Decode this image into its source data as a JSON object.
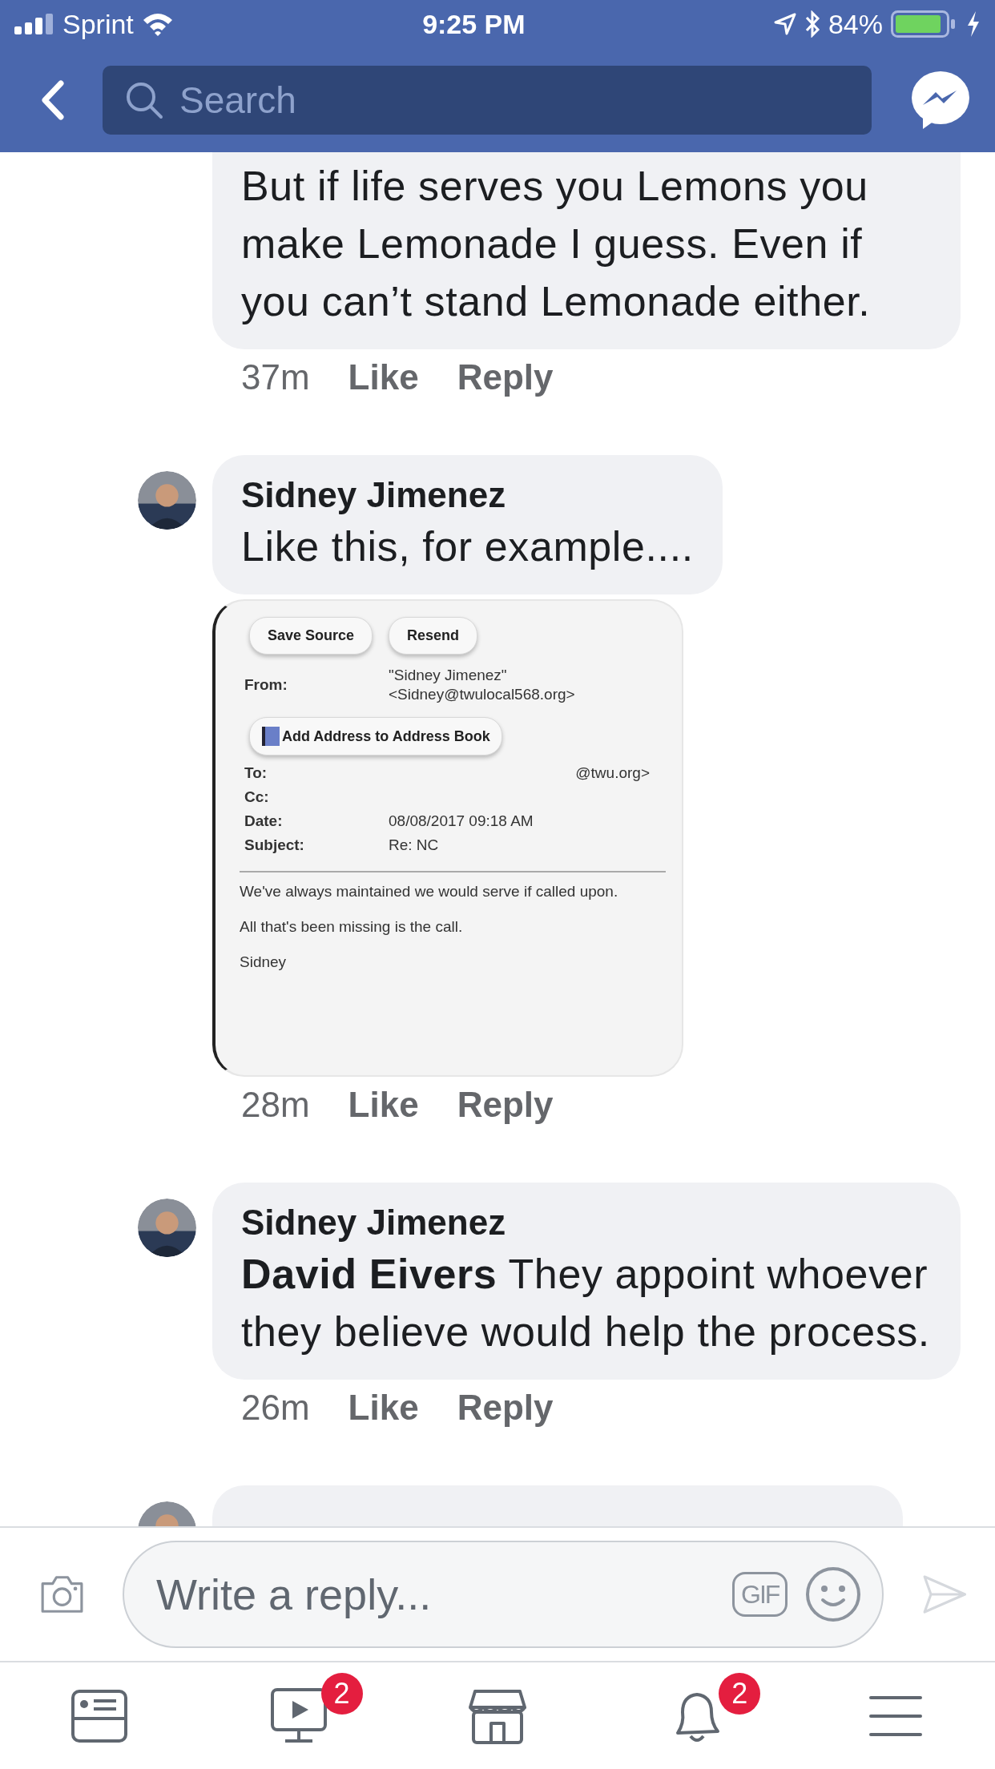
{
  "status_bar": {
    "carrier": "Sprint",
    "time": "9:25 PM",
    "battery": "84%"
  },
  "header": {
    "search": {
      "placeholder": "Search"
    }
  },
  "comments": [
    {
      "kind": "cut",
      "text": "But if life serves you Lemons you make Lemonade I guess. Even if you can’t stand Lemonade either.",
      "time": "37m",
      "like": "Like",
      "reply": "Reply"
    },
    {
      "kind": "full",
      "author": "Sidney Jimenez",
      "text": "Like this, for example....",
      "time": "28m",
      "like": "Like",
      "reply": "Reply",
      "attachment": {
        "buttons": [
          "Save Source",
          "Resend"
        ],
        "from_label": "From:",
        "from_value": [
          "\"Sidney Jimenez\"",
          "<Sidney@twulocal568.org>"
        ],
        "address_button": "Add Address to Address Book",
        "fields": [
          {
            "label": "To:",
            "value": "@twu.org>"
          },
          {
            "label": "Cc:"
          },
          {
            "label": "Date:",
            "value": "08/08/2017 09:18 AM"
          },
          {
            "label": "Subject:",
            "value": "Re: NC"
          }
        ],
        "body": [
          "We've always maintained we would serve if called upon.",
          "All that's been missing is the call.",
          "Sidney"
        ]
      }
    },
    {
      "kind": "full",
      "author": "Sidney Jimenez",
      "text": "**David Eivers** They appoint whoever they believe would help the process.",
      "time": "26m",
      "like": "Like",
      "reply": "Reply"
    },
    {
      "kind": "hidden"
    }
  ],
  "composer": {
    "placeholder": "Write a reply...",
    "gif": "GIF"
  },
  "tab_bar": [
    {
      "kind": "feed"
    },
    {
      "kind": "video",
      "badge": "2"
    },
    {
      "kind": "market"
    },
    {
      "kind": "bell",
      "badge": "2"
    },
    {
      "kind": "menu"
    }
  ]
}
